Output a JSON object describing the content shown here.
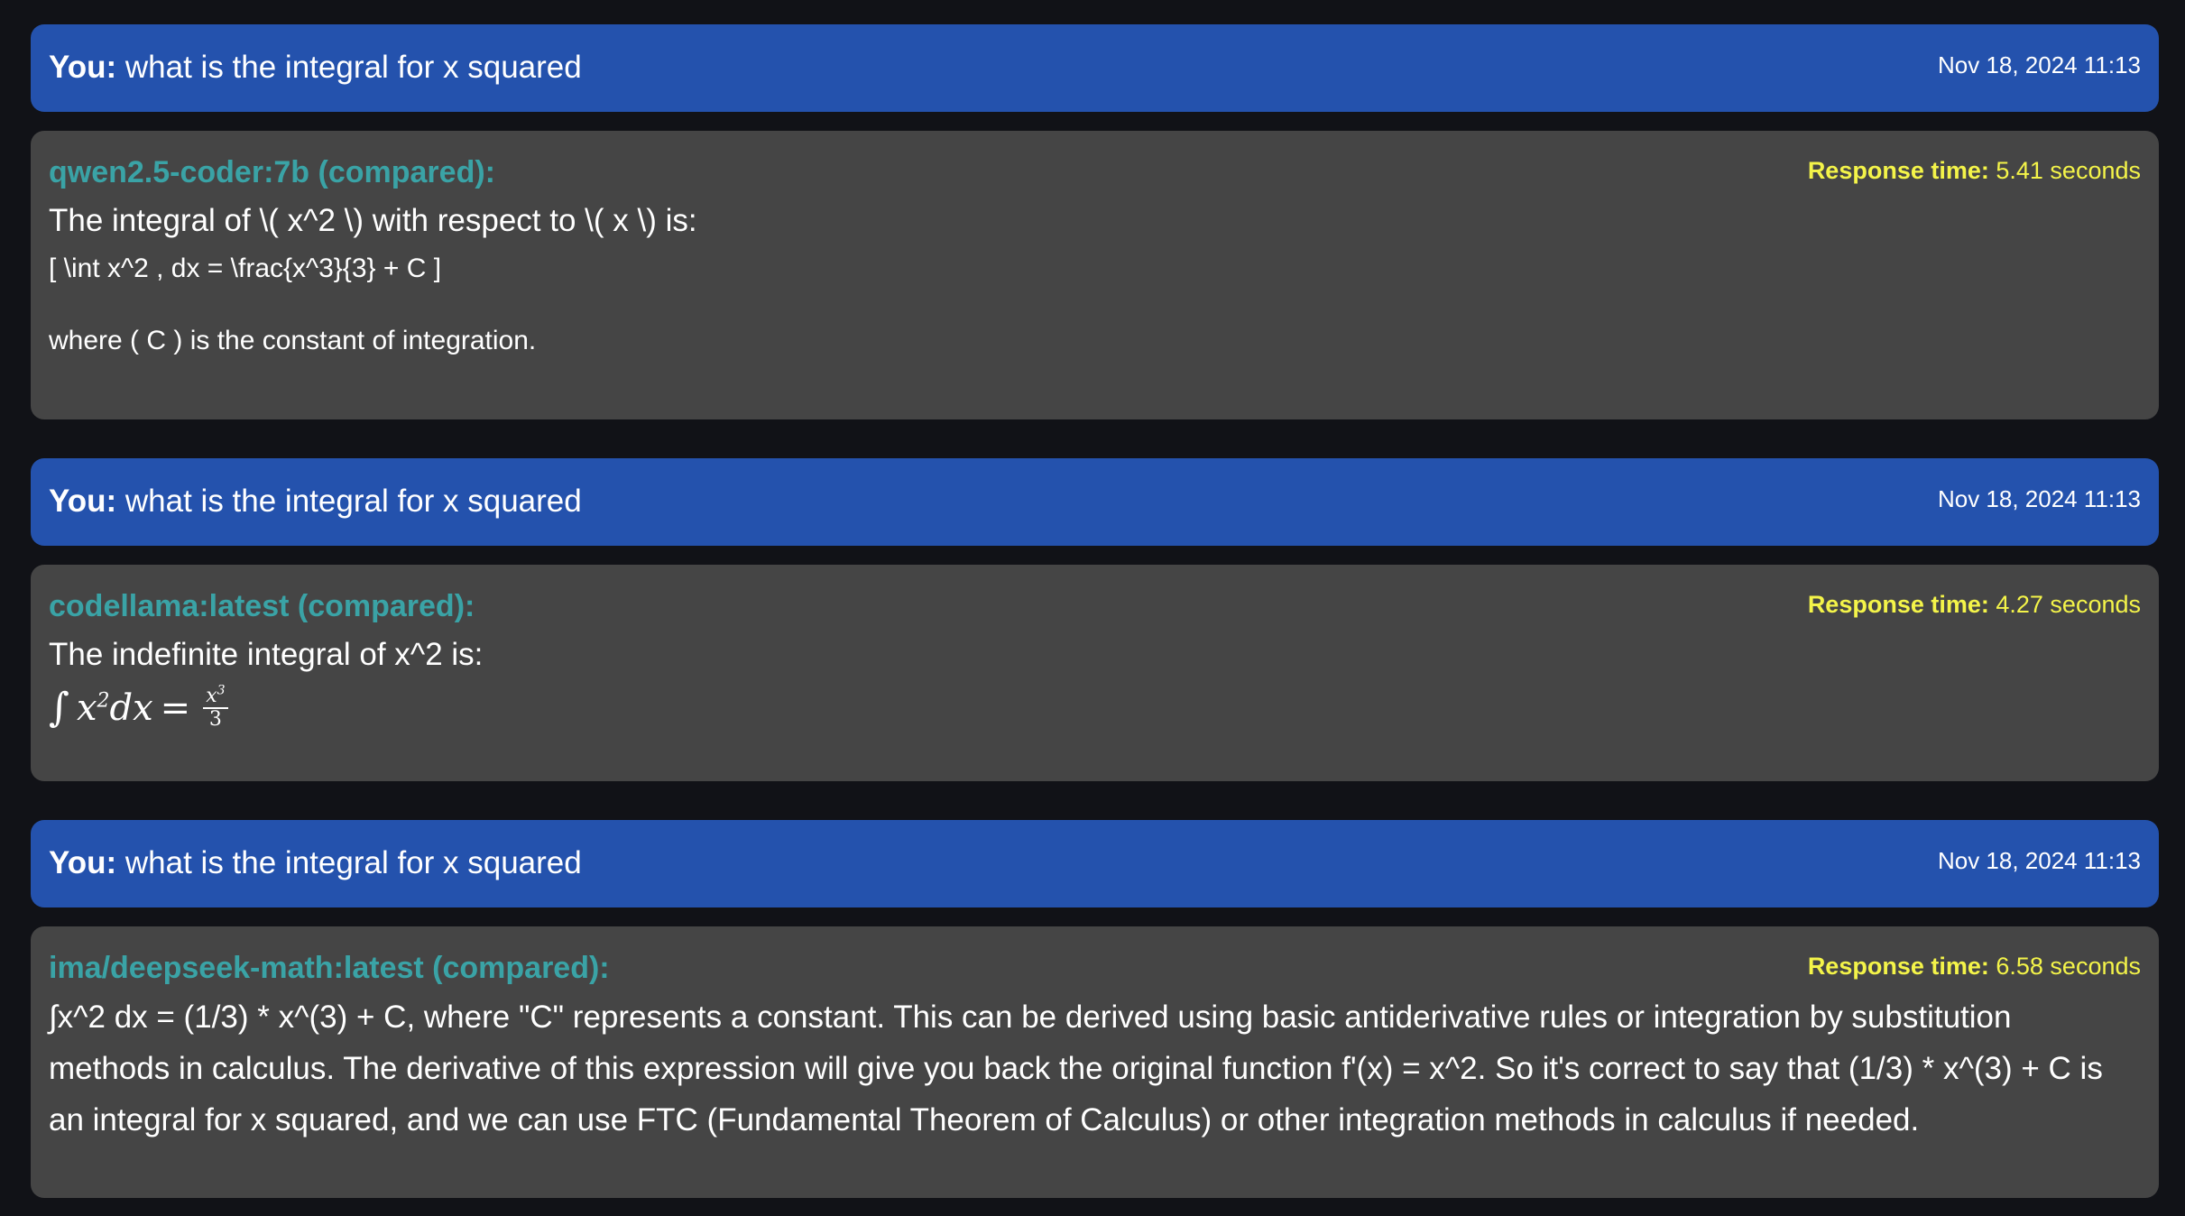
{
  "messages": [
    {
      "user": {
        "prefix": "You:",
        "text": " what is the integral for x squared",
        "timestamp": "Nov 18, 2024 11:13"
      },
      "bot": {
        "model": "qwen2.5-coder:7b (compared):",
        "response_label": "Response time:",
        "response_value": " 5.41 seconds",
        "lines": [
          "The integral of \\( x^2 \\) with respect to \\( x \\) is:",
          "[ \\int x^2 , dx = \\frac{x^3}{3} + C ]",
          "where ( C ) is the constant of integration."
        ]
      }
    },
    {
      "user": {
        "prefix": "You:",
        "text": " what is the integral for x squared",
        "timestamp": "Nov 18, 2024 11:13"
      },
      "bot": {
        "model": "codellama:latest (compared):",
        "response_label": "Response time:",
        "response_value": " 4.27 seconds",
        "lines": [
          "The indefinite integral of x^2 is:"
        ],
        "math": {
          "integral": "∫",
          "base": "x",
          "exp": "2",
          "dx": "dx",
          "equals": "=",
          "num_base": "x",
          "num_exp": "3",
          "den": "3"
        }
      }
    },
    {
      "user": {
        "prefix": "You:",
        "text": " what is the integral for x squared",
        "timestamp": "Nov 18, 2024 11:13"
      },
      "bot": {
        "model": "ima/deepseek-math:latest (compared):",
        "response_label": "Response time:",
        "response_value": " 6.58 seconds",
        "lines": [
          "∫x^2 dx = (1/3) * x^(3) + C, where \"C\" represents a constant. This can be derived using basic antiderivative rules or integration by substitution methods in calculus. The derivative of this expression will give you back the original function f'(x) = x^2. So it's correct to say that (1/3) * x^(3) + C is an integral for x squared, and we can use FTC (Fundamental Theorem of Calculus) or other integration methods in calculus if needed."
        ]
      }
    }
  ]
}
